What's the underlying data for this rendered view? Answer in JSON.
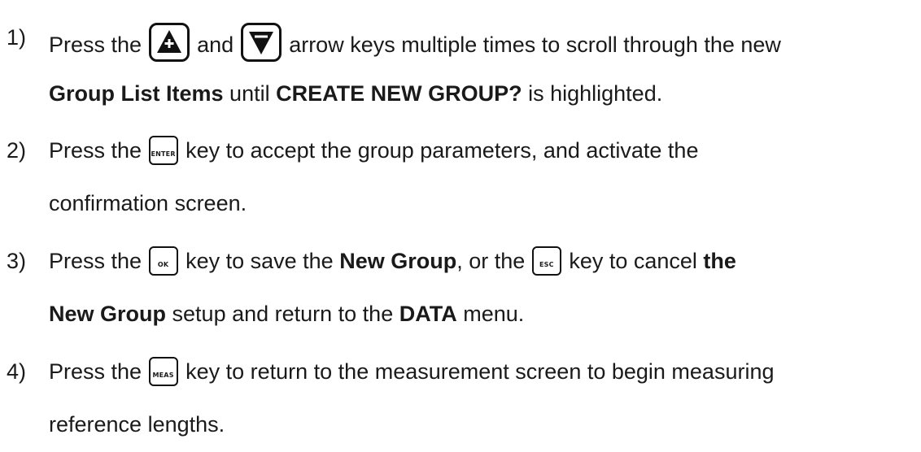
{
  "steps": [
    {
      "number": "1)",
      "lines": [
        {
          "parts": [
            "Press the",
            "and",
            "arrow keys multiple times to scroll through the new"
          ]
        },
        {
          "bold1": "Group List Items",
          "mid": "until",
          "bold2": "CREATE NEW GROUP?",
          "end": "is highlighted."
        }
      ],
      "keys": [
        {
          "name": "up-arrow-key",
          "icon": "up-arrow-icon"
        },
        {
          "name": "down-arrow-key",
          "icon": "down-arrow-icon"
        }
      ]
    },
    {
      "number": "2)",
      "key_label": "ENTER",
      "line1_pre": "Press the",
      "line1_post": "key to accept the group parameters, and activate the",
      "line2": "confirmation screen."
    },
    {
      "number": "3)",
      "key1_label": "OK",
      "key2_label": "ESC",
      "line1_pre": "Press the",
      "line1_mid": "key to save the",
      "line1_bold1": "New Group",
      "line1_mid2": ", or the",
      "line1_mid3": "key to cancel",
      "line1_bold2": "the",
      "line2_bold1": "New Group",
      "line2_mid": "setup and return to the",
      "line2_bold2": "DATA",
      "line2_end": "menu."
    },
    {
      "number": "4)",
      "key_label": "MEAS",
      "line1_pre": "Press the",
      "line1_post": "key to return to the measurement screen to begin measuring",
      "line2": "reference lengths."
    }
  ]
}
